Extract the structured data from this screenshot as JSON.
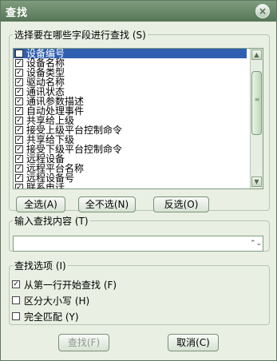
{
  "window": {
    "title": "查找",
    "close_icon": "×"
  },
  "fields": {
    "legend": "选择要在哪些字段进行查找 (S)",
    "items": [
      {
        "label": "设备编号",
        "checked": true,
        "selected": true
      },
      {
        "label": "设备名称",
        "checked": true
      },
      {
        "label": "设备类型",
        "checked": true
      },
      {
        "label": "驱动名称",
        "checked": true
      },
      {
        "label": "通讯状态",
        "checked": true
      },
      {
        "label": "通讯参数描述",
        "checked": true
      },
      {
        "label": "自动处理事件",
        "checked": true
      },
      {
        "label": "共享给上级",
        "checked": true
      },
      {
        "label": "接受上级平台控制命令",
        "checked": true
      },
      {
        "label": "共享给下级",
        "checked": true
      },
      {
        "label": "接受下级平台控制命令",
        "checked": true
      },
      {
        "label": "远程设备",
        "checked": true
      },
      {
        "label": "远程平台名称",
        "checked": true
      },
      {
        "label": "远程设备号",
        "checked": true
      },
      {
        "label": "联系电话",
        "checked": true
      }
    ],
    "buttons": {
      "select_all": "全选(A)",
      "select_none": "全不选(N)",
      "invert": "反选(O)"
    }
  },
  "input": {
    "legend": "输入查找内容 (T)",
    "value": "",
    "dropdown_icon": "⌃⌄"
  },
  "options": {
    "legend": "查找选项 (I)",
    "items": [
      {
        "label": "从第一行开始查找 (F)",
        "checked": true
      },
      {
        "label": "区分大小写 (H)",
        "checked": false
      },
      {
        "label": "完全匹配 (Y)",
        "checked": false
      }
    ]
  },
  "footer": {
    "find": "查找(F)",
    "cancel": "取消(C)"
  },
  "icons": {
    "check": "✓",
    "scroll_up": "▲",
    "scroll_down": "▼",
    "grip": "≡"
  }
}
